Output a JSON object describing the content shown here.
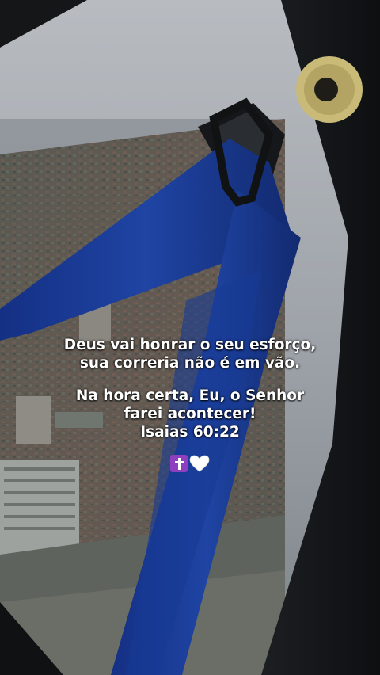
{
  "caption": {
    "line1": "Deus vai honrar o seu esforço,",
    "line2": "sua correria não é em vão.",
    "line3": "Na hora certa, Eu, o Senhor",
    "line4": "farei acontecer!",
    "reference": "Isaias 60:22"
  },
  "emojis": [
    "cross-icon",
    "white-heart-icon"
  ],
  "colors": {
    "strap": "#1d3b8c",
    "sky": "#9aa0a6",
    "text": "#ffffff",
    "cross_bg": "#8e3fbf"
  }
}
